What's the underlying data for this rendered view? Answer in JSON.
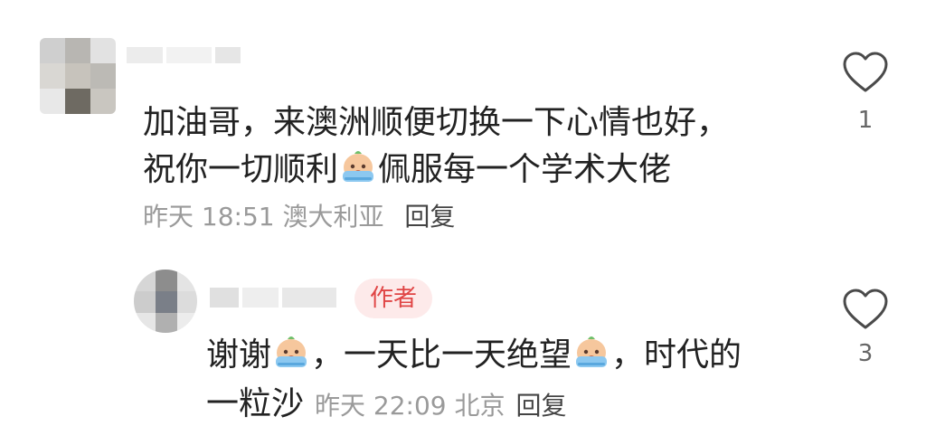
{
  "comments": [
    {
      "text_line1": "加油哥，来澳洲顺便切换一下心情也好，",
      "text_line2_a": "祝你一切顺利",
      "text_line2_b": "佩服每一个学术大佬",
      "time": "昨天 18:51",
      "location": "澳大利亚",
      "reply_label": "回复",
      "likes": "1"
    },
    {
      "author_badge": "作者",
      "text_a": "谢谢",
      "text_b": "，一天比一天绝望",
      "text_c": "，时代的",
      "text_d": "一粒沙",
      "time": "昨天 22:09",
      "location": "北京",
      "reply_label": "回复",
      "likes": "3"
    }
  ],
  "icons": {
    "like": "heart-outline-icon",
    "emoji": "crying-face-emoji"
  },
  "colors": {
    "meta_gray": "#9a9a9a",
    "badge_bg": "#fdeaea",
    "badge_text": "#e04545"
  }
}
